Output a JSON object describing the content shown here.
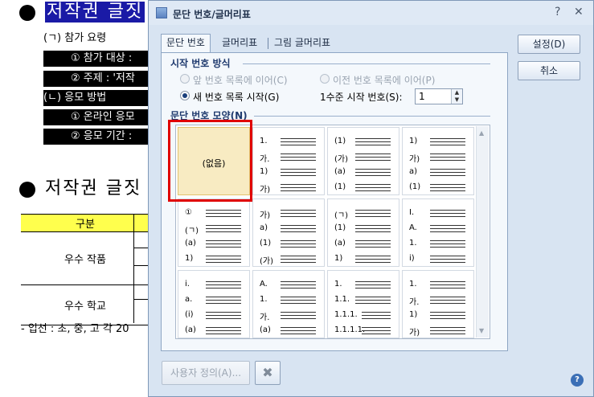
{
  "document": {
    "heading1": "저작권 글짓",
    "items": [
      "(ㄱ) 참가 요령",
      "① 참가 대상 :",
      "② 주제 : '저작",
      "(ㄴ) 응모 방법",
      "① 온라인 응모",
      "② 응모 기간 :"
    ],
    "heading2": "저작권 글짓",
    "table": {
      "header": "구분",
      "rows": [
        "우수 작품",
        "우수 학교"
      ]
    },
    "footnote": "- 입선 : 초, 중, 고 각 20"
  },
  "dialog": {
    "title": "문단 번호/글머리표",
    "help_glyph": "?",
    "close_glyph": "✕",
    "tabs": [
      "문단 번호",
      "글머리표",
      "그림 글머리표"
    ],
    "start_section": {
      "label": "시작 번호 방식",
      "options": [
        "앞 번호 목록에 이어(C)",
        "이전 번호 목록에 이어(P)",
        "새 번호 목록 시작(G)"
      ],
      "level_label": "1수준 시작 번호(S):",
      "level_value": "1"
    },
    "shape_section": {
      "label": "문단 번호 모양(N)",
      "none_label": "(없음)",
      "cells": [
        {
          "markers": []
        },
        {
          "markers": [
            "1.",
            "가.",
            "1)",
            "가)"
          ]
        },
        {
          "markers": [
            "(1)",
            "(가)",
            "(a)",
            "(1)"
          ]
        },
        {
          "markers": [
            "1)",
            "가)",
            "a)",
            "(1)"
          ]
        },
        {
          "markers": [
            "①",
            "(ㄱ)",
            "(a)",
            "1)"
          ]
        },
        {
          "markers": [
            "가)",
            "a)",
            "(1)",
            "(가)"
          ]
        },
        {
          "markers": [
            "(ㄱ)",
            "(1)",
            "(a)",
            "1)"
          ]
        },
        {
          "markers": [
            "I.",
            "A.",
            "1.",
            "i)"
          ]
        },
        {
          "markers": [
            "i.",
            "a.",
            "(i)",
            "(a)"
          ]
        },
        {
          "markers": [
            "A.",
            "1.",
            "가.",
            "(a)"
          ]
        },
        {
          "markers": [
            "1.",
            "1.1.",
            "1.1.1.",
            "1.1.1.1."
          ]
        },
        {
          "markers": [
            "1.",
            "가.",
            "1)",
            "가)"
          ]
        }
      ]
    },
    "buttons": {
      "ok": "설정(D)",
      "cancel": "취소",
      "custom": "사용자 정의(A)...",
      "delete_icon": "✖",
      "help_icon": "?"
    }
  },
  "colors": {
    "accent": "#1a1aa6",
    "selection_highlight": "#e00000",
    "selected_cell": "#f8ebc2"
  }
}
